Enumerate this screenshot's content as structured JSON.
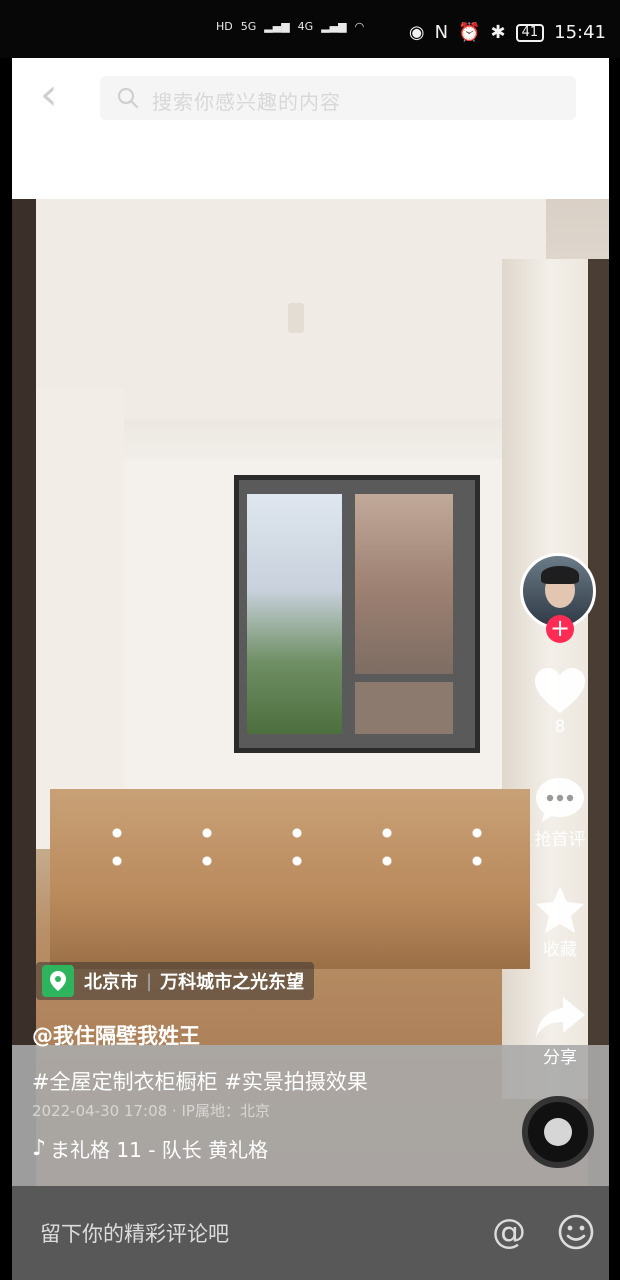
{
  "status_bar": {
    "time": "15:41",
    "battery": "41",
    "network_labels": [
      "HD",
      "5G",
      "4G"
    ]
  },
  "header": {
    "search_placeholder": "搜索你感兴趣的内容"
  },
  "video": {
    "location": {
      "city": "北京市",
      "place": "万科城市之光东望"
    },
    "author": "@我住隔壁我姓王",
    "hashtags": "#全屋定制衣柜橱柜 #实景拍摄效果",
    "meta": "2022-04-30 17:08 · IP属地：北京",
    "music": "ま礼格    11 - 队长  黄礼格"
  },
  "sidebar": {
    "like_count": "8",
    "comment_label": "抢首评",
    "favorite_label": "收藏",
    "share_label": "分享"
  },
  "comment_bar": {
    "placeholder": "留下你的精彩评论吧"
  },
  "icons": {
    "back": "back-arrow-icon",
    "search": "search-icon",
    "location": "location-pin-icon",
    "like": "heart-icon",
    "comment": "comment-icon",
    "favorite": "star-icon",
    "share": "share-arrow-icon",
    "music": "music-note-icon",
    "mention": "at-icon",
    "emoji": "emoji-icon"
  },
  "colors": {
    "follow_badge": "#fe2c55",
    "location_pin": "#2fb45e",
    "comment_bar_bg": "#585858"
  }
}
